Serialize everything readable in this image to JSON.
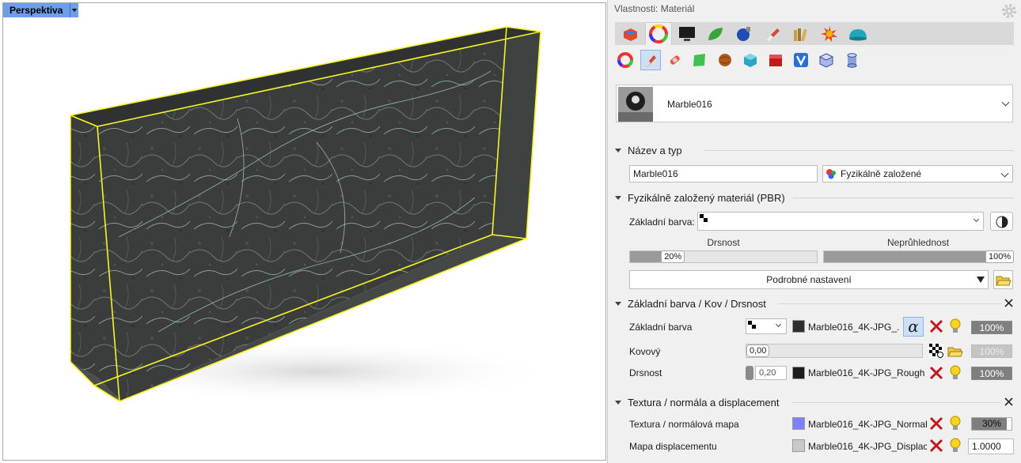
{
  "viewport": {
    "label": "Perspektiva"
  },
  "panel": {
    "title": "Vlastnosti: Materiál",
    "tabs": [
      "object-icon",
      "material-icon",
      "display-icon",
      "environment-icon",
      "render-icon",
      "texture-icon",
      "library-icon",
      "sun-icon",
      "ground-icon"
    ],
    "subtabs": [
      "color-wheel-icon",
      "paint-icon",
      "bandage-icon",
      "plane-icon",
      "sphere-texture-icon",
      "box-texture-icon",
      "red-box-icon",
      "v-icon",
      "cube-map-icon",
      "cylinder-icon"
    ],
    "material": {
      "name": "Marble016"
    },
    "sec_name": {
      "title": "Název a typ",
      "name_value": "Marble016",
      "type_value": "Fyzikálně založené"
    },
    "sec_pbr": {
      "title": "Fyzikálně založený materiál (PBR)",
      "base_color_label": "Základní barva:",
      "roughness_label": "Drsnost",
      "roughness_value": "20%",
      "roughness_level": 0.2,
      "opacity_label": "Neprůhlednost",
      "opacity_value": "100%",
      "opacity_level": 1.0,
      "advanced_label": "Podrobné nastavení"
    },
    "sec_base": {
      "title": "Základní barva / Kov / Drsnost",
      "rows": [
        {
          "label": "Základní barva",
          "tex": "Marble016_4K-JPG_...",
          "pct": "100%"
        },
        {
          "label": "Kovový",
          "value": "0,00",
          "pct": "100%"
        },
        {
          "label": "Drsnost",
          "value": "0,20",
          "tex": "Marble016_4K-JPG_Rough...",
          "pct": "100%"
        }
      ]
    },
    "sec_tex": {
      "title": "Textura / normála a displacement",
      "rows": [
        {
          "label": "Textura / normálová mapa",
          "tex": "Marble016_4K-JPG_Normal...",
          "pct": "30%",
          "level": 0.3
        },
        {
          "label": "Mapa displacementu",
          "tex": "Marble016_4K-JPG_Displac...",
          "value": "1.0000"
        }
      ]
    },
    "colors": {
      "accent": "#6d9eea",
      "selection": "#ffff33",
      "normal_swatch": "#8080ff"
    }
  }
}
